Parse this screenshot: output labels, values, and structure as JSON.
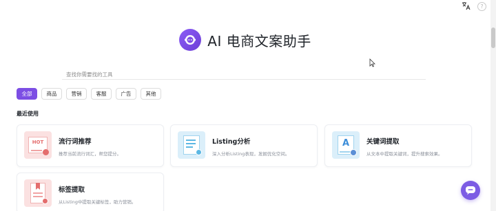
{
  "topbar": {
    "translate_icon": "translate-icon",
    "help_icon": "help-icon",
    "help_glyph": "?"
  },
  "hero": {
    "title": "AI 电商文案助手",
    "logo_icon": "chatbot-logo-icon",
    "brand_color": "#7c4ee4"
  },
  "search": {
    "placeholder": "查找你需要找的工具",
    "value": ""
  },
  "tabs": [
    {
      "label": "全部",
      "active": true
    },
    {
      "label": "商品",
      "active": false
    },
    {
      "label": "营销",
      "active": false
    },
    {
      "label": "客服",
      "active": false
    },
    {
      "label": "广告",
      "active": false
    },
    {
      "label": "其他",
      "active": false
    }
  ],
  "recent": {
    "title": "最近使用",
    "tools": [
      {
        "name": "流行词推荐",
        "desc": "推荐当前流行词汇，帮您提分。",
        "icon": "hot-words-icon",
        "badge_text": "HOT"
      },
      {
        "name": "Listing分析",
        "desc": "深入分析Listing表现，发掘优化空间。",
        "icon": "listing-analysis-icon"
      },
      {
        "name": "关键词提取",
        "desc": "从文本中提取关键词，提升搜索效果。",
        "icon": "keyword-extract-icon",
        "badge_text": "A"
      },
      {
        "name": "标签提取",
        "desc": "从Listing中提取关键标签，助力营销。",
        "icon": "tag-extract-icon"
      }
    ]
  },
  "chat_fab": {
    "icon": "chat-bubble-icon"
  }
}
